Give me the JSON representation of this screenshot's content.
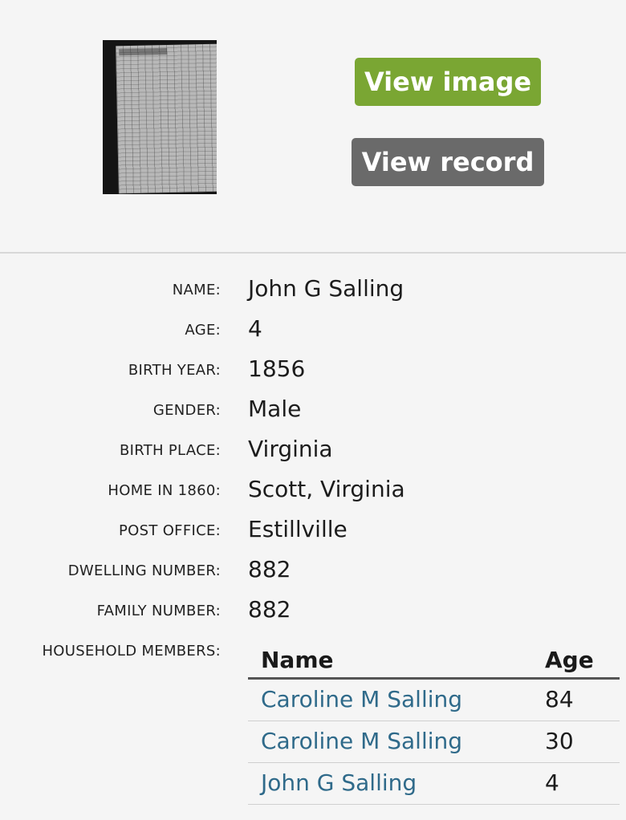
{
  "actions": {
    "view_image_label": "View image",
    "view_record_label": "View record"
  },
  "record": {
    "name_label": "NAME:",
    "name": "John G Salling",
    "age_label": "AGE:",
    "age": "4",
    "birth_year_label": "BIRTH YEAR:",
    "birth_year": "1856",
    "gender_label": "GENDER:",
    "gender": "Male",
    "birth_place_label": "BIRTH PLACE:",
    "birth_place": "Virginia",
    "home_label": "HOME IN 1860:",
    "home": "Scott, Virginia",
    "post_office_label": "POST OFFICE:",
    "post_office": "Estillville",
    "dwelling_label": "DWELLING NUMBER:",
    "dwelling": "882",
    "family_label": "FAMILY NUMBER:",
    "family": "882",
    "household_label": "HOUSEHOLD MEMBERS:"
  },
  "household": {
    "col_name": "Name",
    "col_age": "Age",
    "members": [
      {
        "name": "Caroline M Salling",
        "age": "84"
      },
      {
        "name": "Caroline M Salling",
        "age": "30"
      },
      {
        "name": "John G Salling",
        "age": "4"
      }
    ]
  },
  "colors": {
    "view_image_button": "#7aa633",
    "view_record_button": "#6a6a6a",
    "member_link": "#2f6a8a"
  }
}
